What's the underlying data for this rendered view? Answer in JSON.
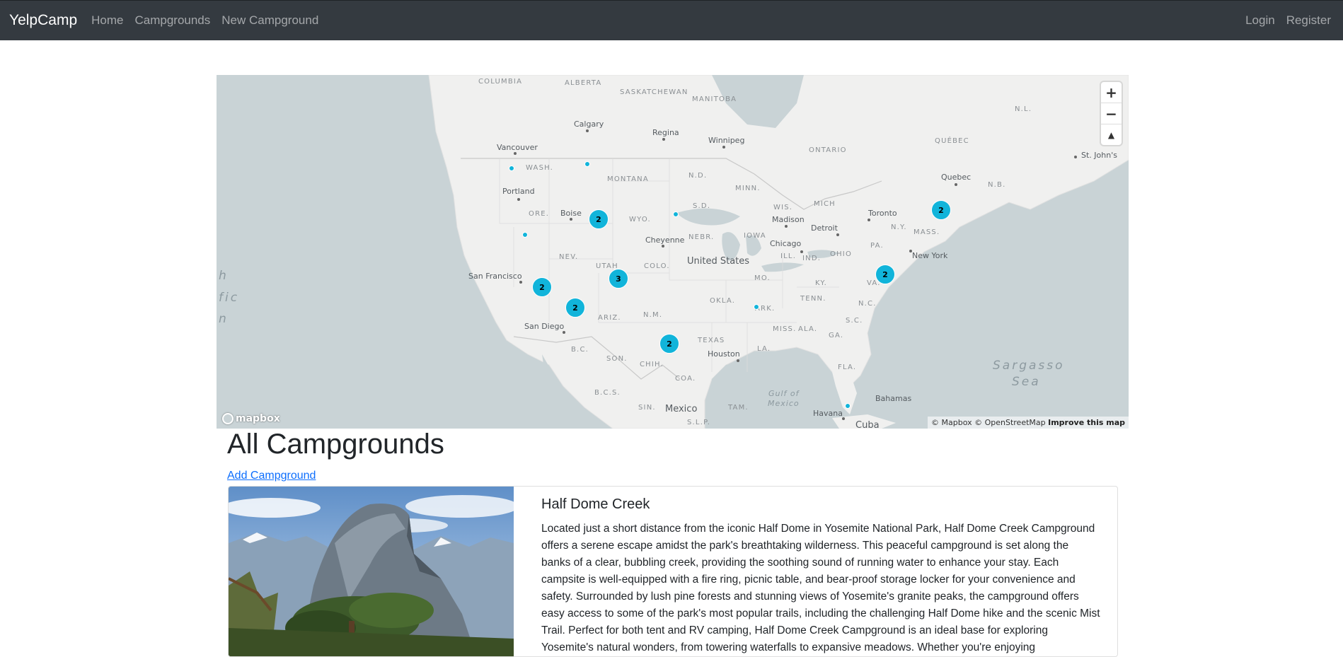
{
  "navbar": {
    "brand": "YelpCamp",
    "links": [
      "Home",
      "Campgrounds",
      "New Campground"
    ],
    "right_links": [
      "Login",
      "Register"
    ]
  },
  "map": {
    "region_labels": [
      "COLUMBIA",
      "ALBERTA",
      "SASKATCHEWAN",
      "MANITOBA",
      "ONTARIO",
      "QUÉBEC",
      "N.L.",
      "N.B.",
      "WASH.",
      "MONTANA",
      "N.D.",
      "MINN.",
      "WIS.",
      "MICH",
      "ORE.",
      "WYO.",
      "S.D.",
      "N.Y.",
      "NEBR.",
      "IOWA",
      "MASS.",
      "NEV.",
      "UTAH",
      "COLO.",
      "ILL.",
      "IND.",
      "OHIO",
      "PA.",
      "MO.",
      "KY.",
      "VA.",
      "OKLA.",
      "ARK.",
      "TENN.",
      "N.C.",
      "ARIZ.",
      "N.M.",
      "MISS.",
      "ALA.",
      "S.C.",
      "GA.",
      "TEXAS",
      "LA.",
      "FLA.",
      "SON.",
      "CHIH.",
      "COA.",
      "B.C.S.",
      "SIN.",
      "S.L.P.",
      "TAM.",
      "B.C."
    ],
    "city_labels": [
      "Calgary",
      "Regina",
      "Winnipeg",
      "Vancouver",
      "Portland",
      "Boise",
      "Cheyenne",
      "Madison",
      "Toronto",
      "Detroit",
      "Quebec",
      "St. John's",
      "Chicago",
      "New York",
      "San Francisco",
      "San Diego",
      "Houston",
      "Bahamas",
      "Havana"
    ],
    "country_labels": [
      "United States",
      "Mexico",
      "Cuba"
    ],
    "ocean_labels": [
      "Sargasso",
      "Sea",
      "Gulf of",
      "Mexico",
      "h",
      "fic",
      "n"
    ],
    "clusters": [
      "2",
      "3",
      "2",
      "2",
      "2",
      "2",
      "2"
    ],
    "zoom_in": "+",
    "zoom_out": "−",
    "compass": "▲",
    "logo": "mapbox",
    "attribution": "© Mapbox © OpenStreetMap",
    "improve": "Improve this map"
  },
  "page": {
    "title": "All Campgrounds",
    "add_link": "Add Campground"
  },
  "campgrounds": [
    {
      "title": "Half Dome Creek",
      "description": "Located just a short distance from the iconic Half Dome in Yosemite National Park, Half Dome Creek Campground offers a serene escape amidst the park's breathtaking wilderness. This peaceful campground is set along the banks of a clear, bubbling creek, providing the soothing sound of running water to enhance your stay. Each campsite is well-equipped with a fire ring, picnic table, and bear-proof storage locker for your convenience and safety. Surrounded by lush pine forests and stunning views of Yosemite's granite peaks, the campground offers easy access to some of the park's most popular trails, including the challenging Half Dome hike and the scenic Mist Trail. Perfect for both tent and RV camping, Half Dome Creek Campground is an ideal base for exploring Yosemite's natural wonders, from towering waterfalls to expansive meadows. Whether you're enjoying"
    }
  ],
  "colors": {
    "navbar_bg": "#343a40",
    "cluster": "#11b4da",
    "link": "#0d6efd"
  }
}
